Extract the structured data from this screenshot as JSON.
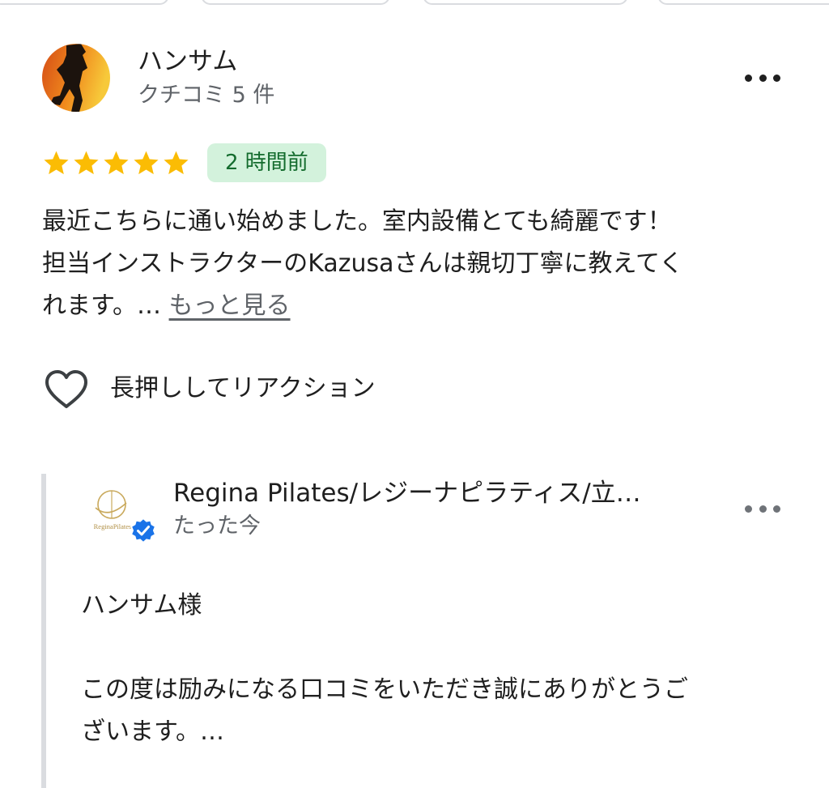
{
  "review": {
    "reviewer_name": "ハンサム",
    "reviewer_review_count": "クチコミ 5 件",
    "rating": 5,
    "rating_max": 5,
    "time_ago": "2 時間前",
    "text_lines": [
      "最近こちらに通い始めました。室内設備とても綺麗です！",
      "担当インストラクターのKazusaさんは親切丁寧に教えてく",
      "れます。… "
    ],
    "more_link": "もっと見る",
    "reaction_label": "長押ししてリアクション"
  },
  "owner_reply": {
    "owner_name": "Regina Pilates/レジーナピラティス/立…",
    "logo_text": "ReginaPilates",
    "time_ago": "たった今",
    "text_lines": [
      "ハンサム様",
      "",
      "この度は励みになる口コミをいただき誠にありがとうご",
      "ざいます。…"
    ]
  },
  "colors": {
    "star": "#fbbc04",
    "badge_bg": "#d3f2dc",
    "badge_text": "#146c2e",
    "verified": "#1a73e8",
    "secondary_text": "#5f6368",
    "reply_bar": "#dadce0"
  },
  "icons": {
    "menu": "more-horiz-icon",
    "reaction": "heart-outline-icon",
    "verified": "verified-check-icon",
    "star": "star-icon"
  }
}
